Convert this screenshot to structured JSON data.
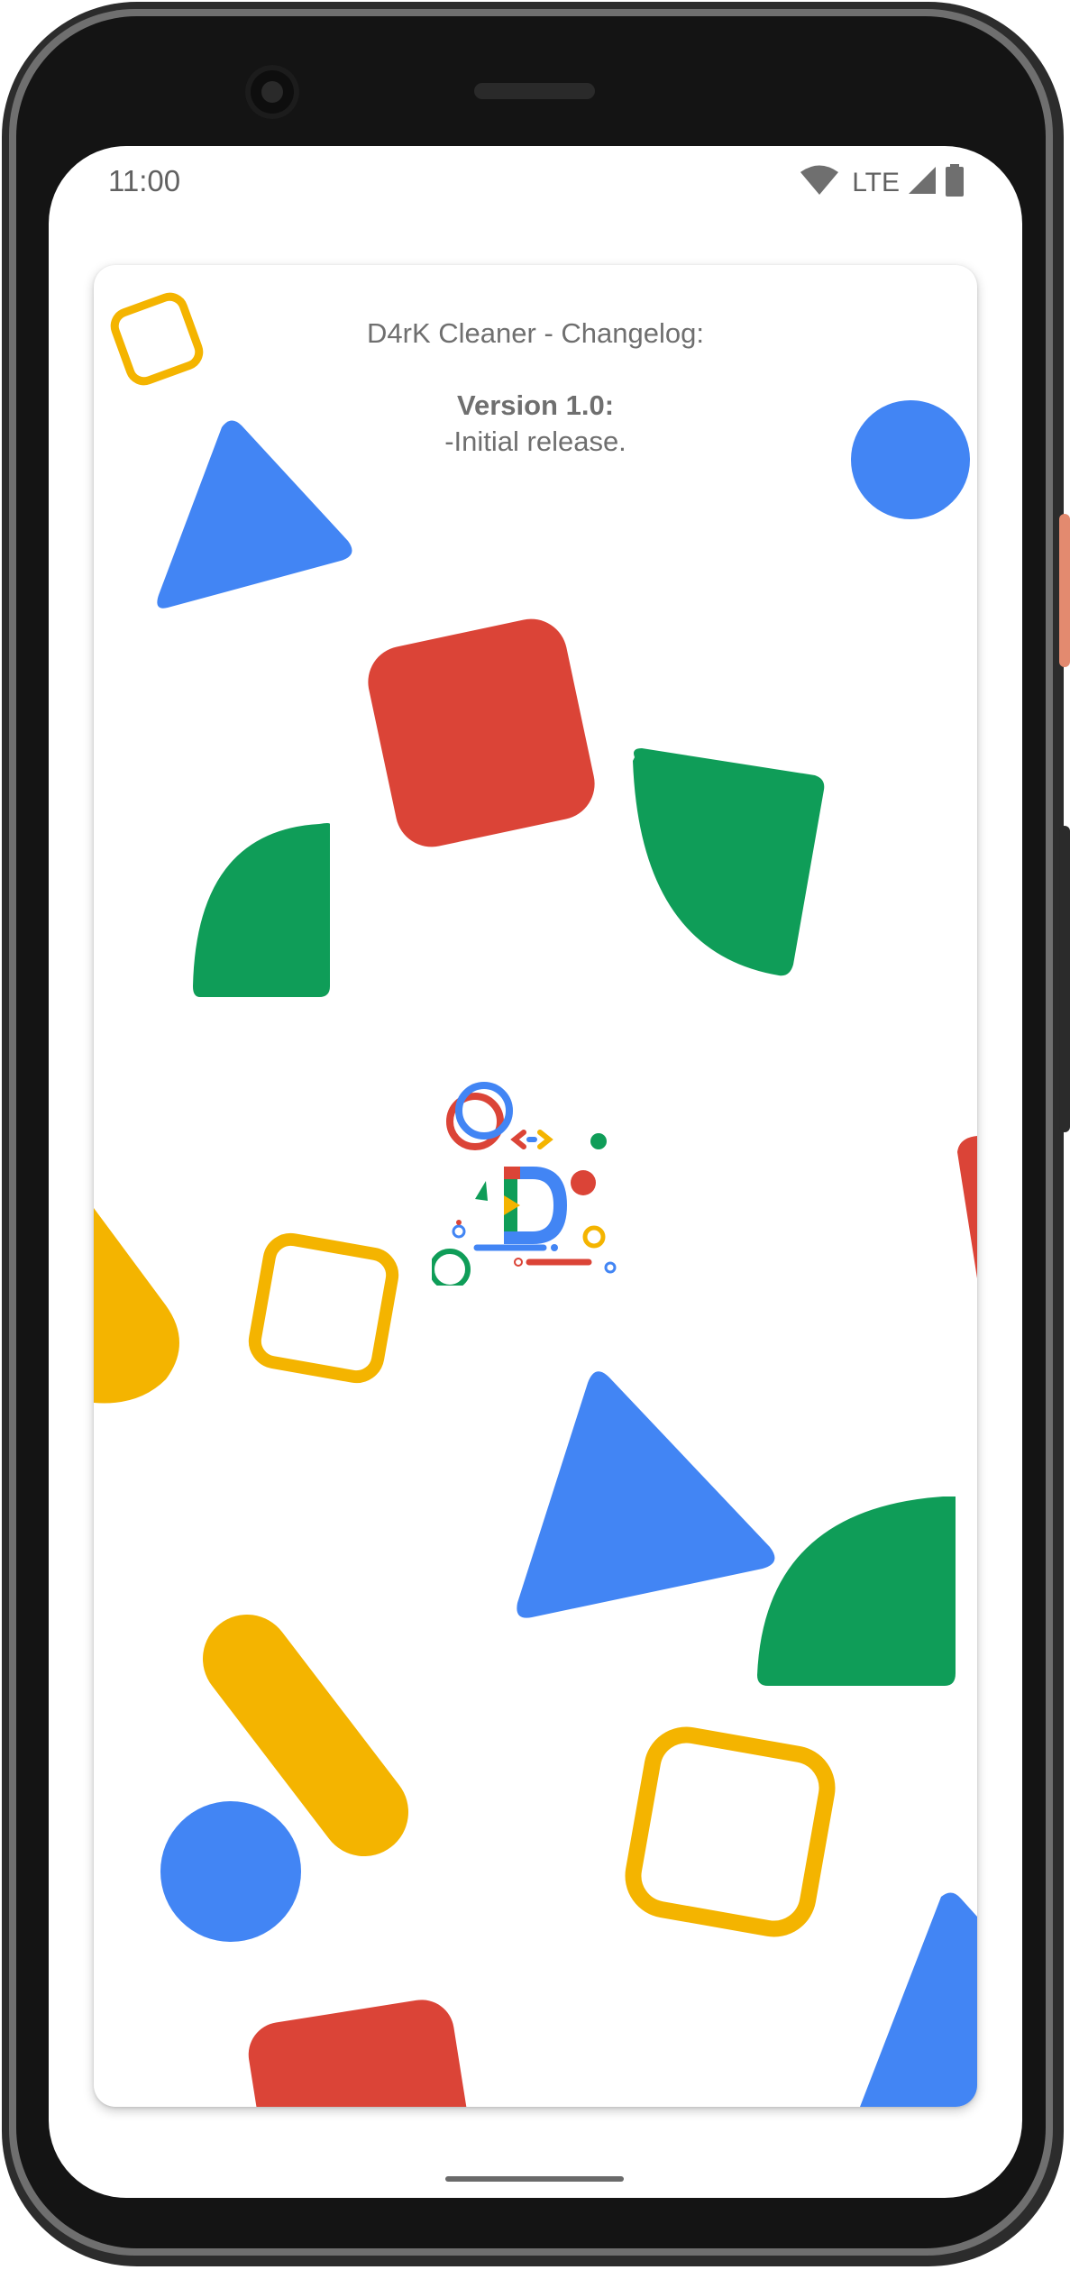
{
  "status_bar": {
    "time": "11:00",
    "network": "LTE",
    "icons": [
      "wifi-icon",
      "cell-signal-icon",
      "battery-icon"
    ]
  },
  "changelog": {
    "title": "D4rK Cleaner - Changelog:",
    "version_label": "Version 1.0:",
    "note": "-Initial release."
  },
  "logo": {
    "letter": "D"
  },
  "colors": {
    "blue": "#4285F4",
    "red": "#DB4437",
    "yellow": "#F4B400",
    "green": "#0F9D58",
    "text": "#6F6F6F"
  }
}
